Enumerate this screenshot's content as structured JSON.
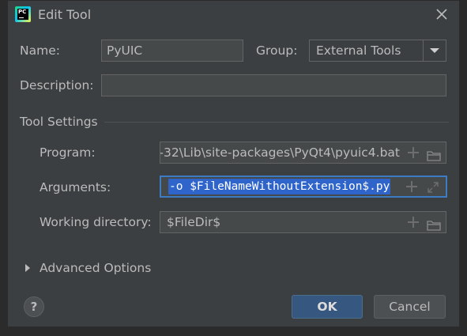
{
  "window": {
    "title": "Edit Tool",
    "app_icon_text": "PC"
  },
  "form": {
    "name_label": "Name:",
    "name_value": "PyUIC",
    "group_label": "Group:",
    "group_value": "External Tools",
    "description_label": "Description:",
    "description_value": ""
  },
  "tool_settings": {
    "title": "Tool Settings",
    "program_label": "Program:",
    "program_value": "'-32\\Lib\\site-packages\\PyQt4\\pyuic4.bat",
    "arguments_label": "Arguments:",
    "arguments_value": "-o $FileNameWithoutExtension$.py",
    "working_directory_label": "Working directory:",
    "working_directory_value": "$FileDir$"
  },
  "advanced": {
    "label": "Advanced Options"
  },
  "buttons": {
    "help": "?",
    "ok": "OK",
    "cancel": "Cancel"
  },
  "colors": {
    "accent": "#365880",
    "selection": "#2f65ca",
    "focus_border": "#3d7bc4",
    "background": "#3c3f41"
  }
}
